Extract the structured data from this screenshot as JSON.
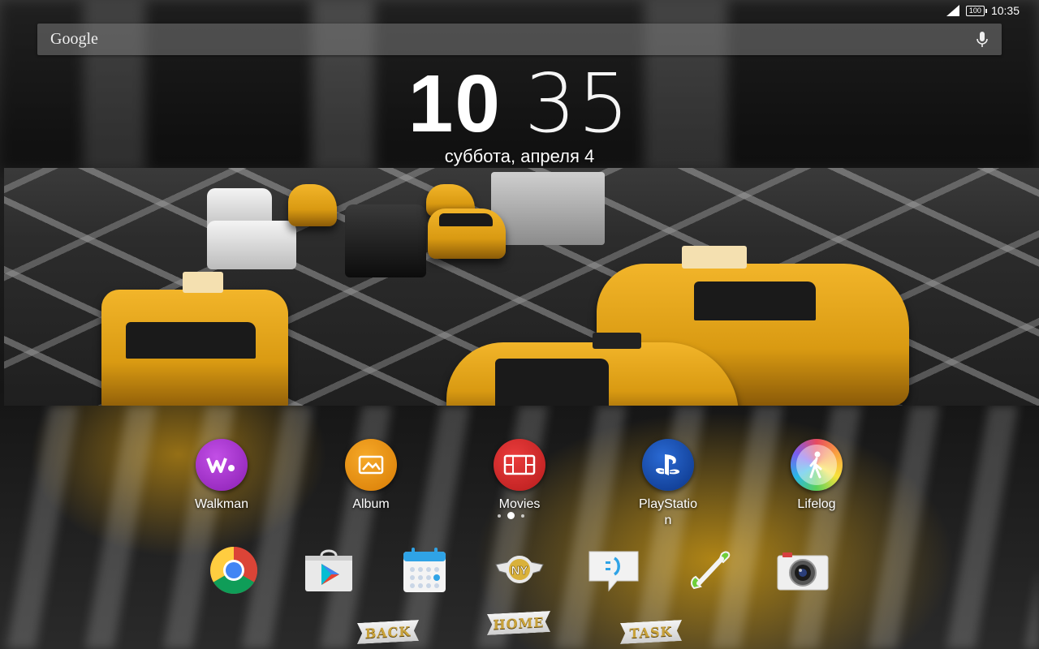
{
  "status_bar": {
    "battery": "100",
    "time": "10:35"
  },
  "search": {
    "logo": "Google"
  },
  "clock": {
    "hours": "10",
    "minutes": "35",
    "date": "суббота, апреля 4"
  },
  "apps": [
    {
      "label": "Walkman",
      "icon": "walkman-icon",
      "color": "#9b2fc2"
    },
    {
      "label": "Album",
      "icon": "album-icon",
      "color": "#e8900c"
    },
    {
      "label": "Movies",
      "icon": "movies-icon",
      "color": "#d0262a"
    },
    {
      "label": "PlayStatio\nn",
      "icon": "playstation-icon",
      "color": "#1a4ea8"
    },
    {
      "label": "Lifelog",
      "icon": "lifelog-icon",
      "color": "#dddddd"
    }
  ],
  "dock": [
    {
      "icon": "chrome-icon"
    },
    {
      "icon": "play-store-icon"
    },
    {
      "icon": "calendar-icon"
    },
    {
      "icon": "ny-badge-icon",
      "badge_text": "NY"
    },
    {
      "icon": "messaging-icon"
    },
    {
      "icon": "phone-icon"
    },
    {
      "icon": "camera-icon"
    }
  ],
  "nav": {
    "back": "BACK",
    "home": "HOME",
    "task": "TASK"
  }
}
